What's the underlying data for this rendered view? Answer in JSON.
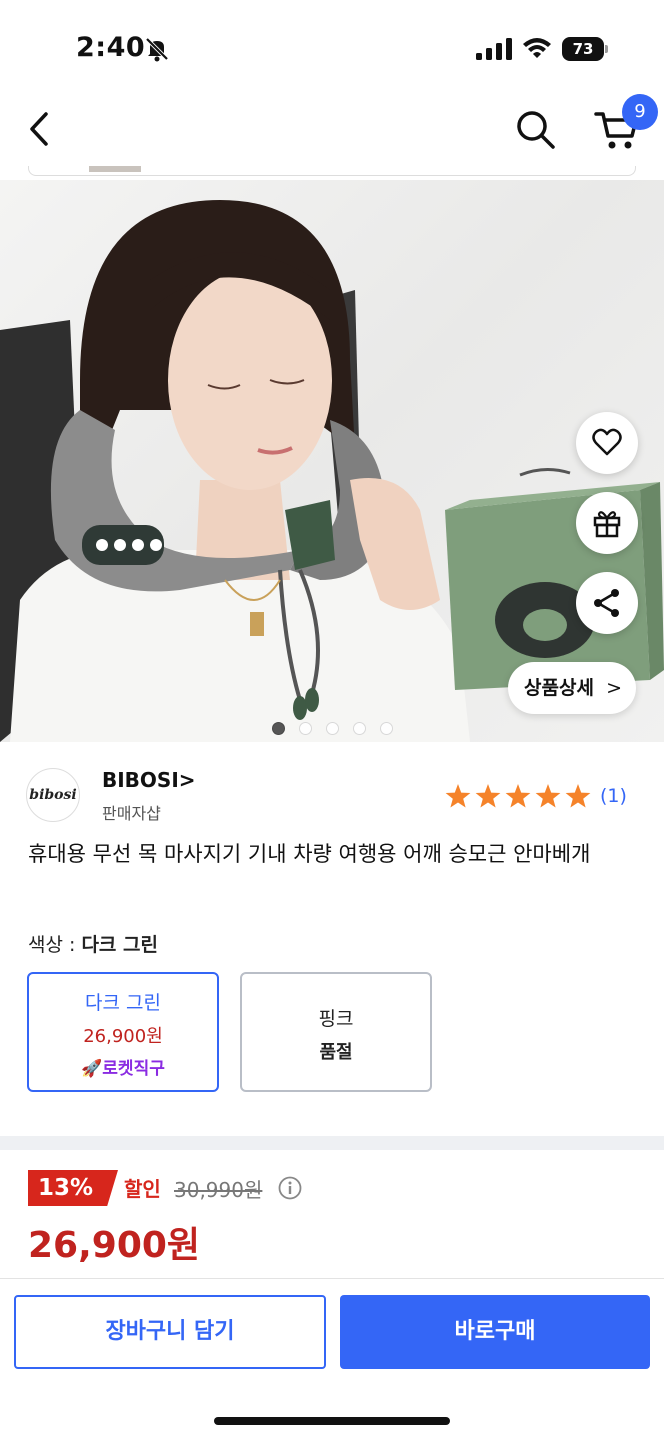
{
  "status_bar": {
    "time": "2:40",
    "battery": "73",
    "icons": [
      "bell-slash-icon",
      "signal-icon",
      "wifi-icon",
      "battery-icon"
    ]
  },
  "nav": {
    "icons": [
      "back-icon",
      "search-icon",
      "cart-icon"
    ],
    "cart_count": "9"
  },
  "hero": {
    "floating_icons": [
      "heart-icon",
      "gift-icon",
      "share-icon"
    ],
    "detail_button": "상품상세",
    "detail_chevron": ">",
    "page_count": 5,
    "active_page": 1
  },
  "seller": {
    "logo_text": "bibosi",
    "name": "BIBOSI",
    "chevron": ">",
    "subtitle": "판매자샵",
    "rating": 5,
    "review_count": "(1)"
  },
  "product": {
    "title": "휴대용 무선 목 마사지기 기내 차량 여행용 어깨 승모근 안마베개"
  },
  "options": {
    "color_label": "색상 : ",
    "selected_color": "다크 그린",
    "items": [
      {
        "name": "다크 그린",
        "price": "26,900원",
        "tag": "로켓직구"
      },
      {
        "name": "핑크",
        "stock": "품절"
      }
    ]
  },
  "price": {
    "discount_rate": "13%",
    "discount_label": "할인",
    "original": "30,990원",
    "final": "26,900원"
  },
  "bottom": {
    "cart_button": "장바구니 담기",
    "buy_button": "바로구매"
  },
  "colors": {
    "accent": "#3466f6",
    "price_red": "#c0231f",
    "star": "#f5832a",
    "rocket": "#8a2be2"
  }
}
